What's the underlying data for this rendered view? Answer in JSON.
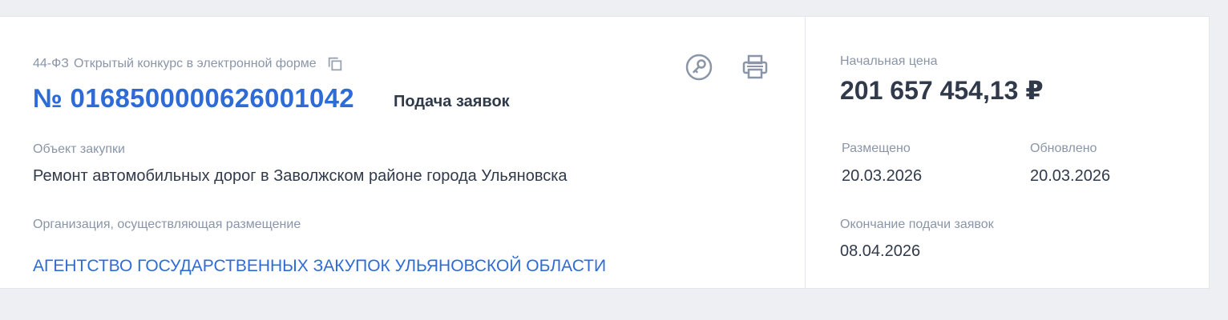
{
  "header": {
    "law": "44-ФЗ",
    "procedure_type": "Открытый конкурс в электронной форме",
    "registry_number": "№ 0168500000626001042",
    "stage": "Подача заявок"
  },
  "purchase": {
    "object_label": "Объект закупки",
    "object_value": "Ремонт автомобильных дорог в Заволжском районе города Ульяновска",
    "organization_label": "Организация, осуществляющая размещение",
    "organization_value": "АГЕНТСТВО ГОСУДАРСТВЕННЫХ ЗАКУПОК УЛЬЯНОВСКОЙ ОБЛАСТИ"
  },
  "side": {
    "price_label": "Начальная цена",
    "price_value": "201 657 454,13 ₽",
    "posted_label": "Размещено",
    "posted_value": "20.03.2026",
    "updated_label": "Обновлено",
    "updated_value": "20.03.2026",
    "deadline_label": "Окончание подачи заявок",
    "deadline_value": "08.04.2026"
  },
  "icons": {
    "copy": "copy-icon",
    "key": "key-icon",
    "print": "printer-icon"
  },
  "colors": {
    "accent": "#2e6bd6",
    "text": "#303a4a",
    "muted": "#8a95a8",
    "background": "#eeeff2"
  }
}
